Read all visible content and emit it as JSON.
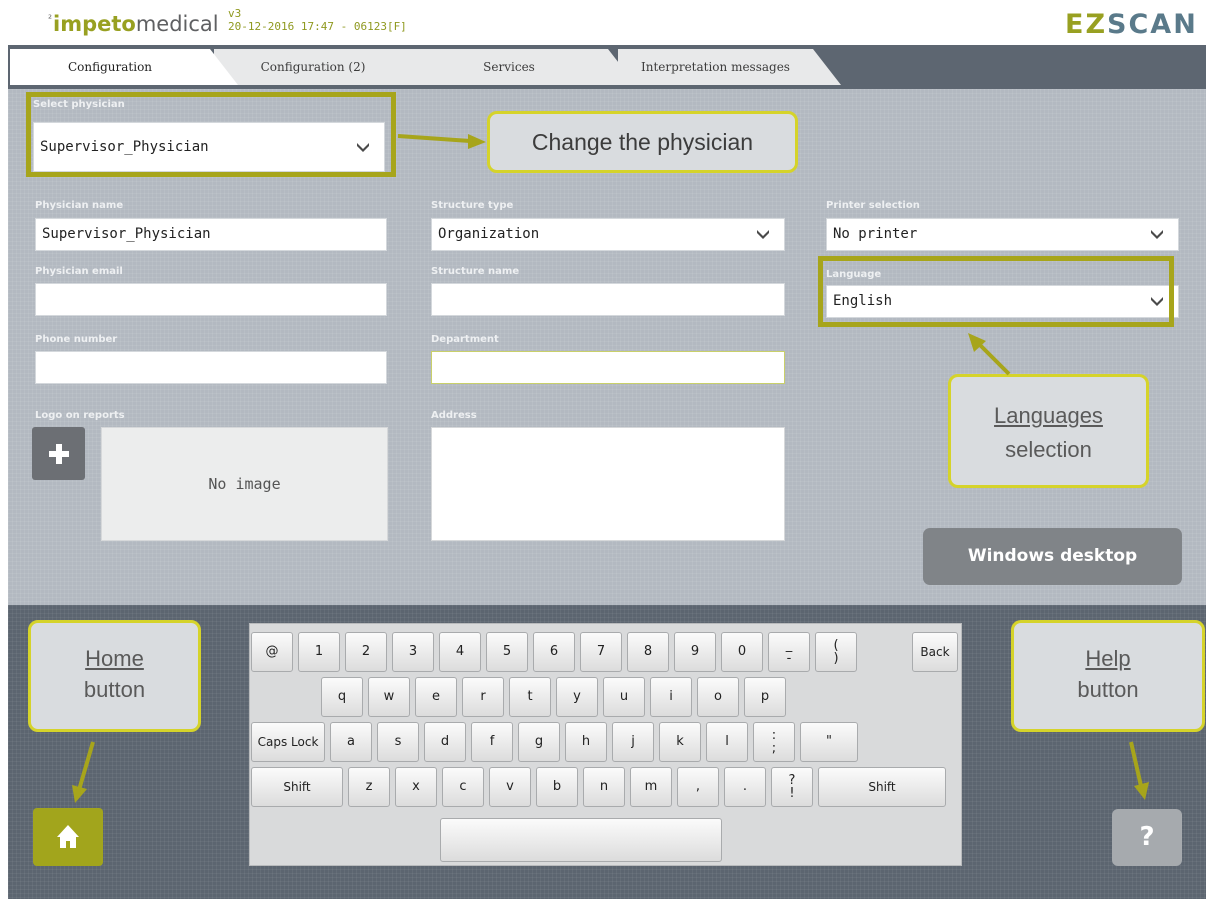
{
  "header": {
    "logo_sup": "²",
    "logo_impeto": "impeto",
    "logo_medical": "medical",
    "version": "v3",
    "datetime": "20-12-2016 17:47 - 06123[F]",
    "brand_ez": "EZ",
    "brand_scan": "SCAN"
  },
  "tabs": [
    {
      "label": "Configuration",
      "active": true
    },
    {
      "label": "Configuration (2)",
      "active": false
    },
    {
      "label": "Services",
      "active": false
    },
    {
      "label": "Interpretation messages",
      "active": false
    }
  ],
  "form": {
    "select_physician_label": "Select physician",
    "select_physician_value": "Supervisor_Physician",
    "physician_name_label": "Physician name",
    "physician_name_value": "Supervisor_Physician",
    "physician_email_label": "Physician email",
    "physician_email_value": "",
    "phone_label": "Phone number",
    "phone_value": "",
    "logo_label": "Logo on reports",
    "no_image": "No image",
    "structure_type_label": "Structure type",
    "structure_type_value": "Organization",
    "structure_name_label": "Structure name",
    "structure_name_value": "",
    "department_label": "Department",
    "department_value": "",
    "address_label": "Address",
    "address_value": "",
    "printer_label": "Printer selection",
    "printer_value": "No printer",
    "language_label": "Language",
    "language_value": "English",
    "windows_desktop": "Windows desktop"
  },
  "callouts": {
    "change_physician": "Change the physician",
    "languages_line1": "Languages",
    "languages_line2": "selection",
    "home_line1": "Home",
    "home_line2": "button",
    "help_line1": "Help",
    "help_line2": "button"
  },
  "keyboard": {
    "row1": [
      "@",
      "1",
      "2",
      "3",
      "4",
      "5",
      "6",
      "7",
      "8",
      "9",
      "0"
    ],
    "row1_special": {
      "dash_top": "_",
      "dash_bottom": "-",
      "paren_top": "(",
      "paren_bottom": ")",
      "back": "Back"
    },
    "row2": [
      "q",
      "w",
      "e",
      "r",
      "t",
      "y",
      "u",
      "i",
      "o",
      "p"
    ],
    "row3": [
      "a",
      "s",
      "d",
      "f",
      "g",
      "h",
      "j",
      "k",
      "l"
    ],
    "row3_special": {
      "caps": "Caps Lock",
      "semi_top": ":",
      "semi_bottom": ";",
      "quote": "\""
    },
    "row4": [
      "z",
      "x",
      "c",
      "v",
      "b",
      "n",
      "m",
      ",",
      "."
    ],
    "row4_special": {
      "shift_left": "Shift",
      "q_top": "?",
      "q_bottom": "!",
      "shift_right": "Shift"
    }
  },
  "help_symbol": "?",
  "colors": {
    "accent": "#98a021",
    "highlight": "#a7a51b",
    "callout_border": "#d5d32a",
    "panel": "#b3b9c1",
    "dark": "#5c6570"
  },
  "icons": [
    "chevron-down-icon",
    "plus-icon",
    "home-icon",
    "help-icon"
  ]
}
